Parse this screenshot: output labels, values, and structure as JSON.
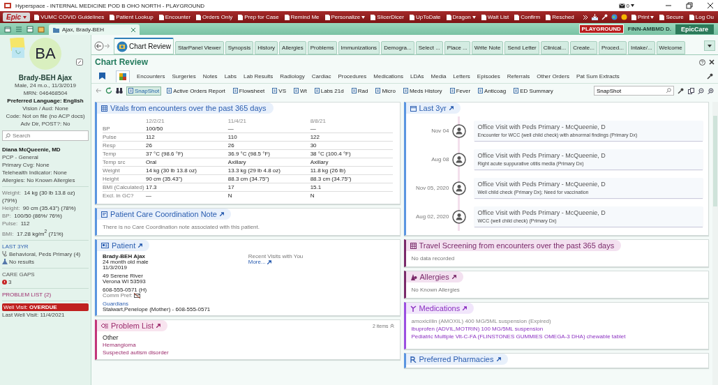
{
  "window": {
    "title": "Hyperspace - INTERNAL MEDICINE POD B OHO NORTH - PLAYGROUND",
    "mail_count": "0"
  },
  "toolbar": {
    "logo": "Epic",
    "items": [
      {
        "label": "VUMC COVID Guidelines",
        "dropdown": false
      },
      {
        "label": "Patient Lookup",
        "dropdown": false
      },
      {
        "label": "Encounter",
        "dropdown": false
      },
      {
        "label": "Orders Only",
        "dropdown": false
      },
      {
        "label": "Prep for Case",
        "dropdown": false
      },
      {
        "label": "Remind Me",
        "dropdown": false
      },
      {
        "label": "Personalize",
        "dropdown": true
      },
      {
        "label": "SlicerDicer",
        "dropdown": false
      },
      {
        "label": "UpToDate",
        "dropdown": false
      },
      {
        "label": "Dragon",
        "dropdown": true
      },
      {
        "label": "Wait List",
        "dropdown": false
      },
      {
        "label": "Confirm",
        "dropdown": false
      },
      {
        "label": "Resched",
        "dropdown": false
      }
    ],
    "right_items": [
      {
        "label": "Print",
        "dropdown": true
      },
      {
        "label": "Secure",
        "dropdown": false
      },
      {
        "label": "Log Ou",
        "dropdown": false
      }
    ]
  },
  "workspace_tabs": {
    "patient_tab": "Ajax, Brady-BEH",
    "environment": "PLAYGROUND",
    "user": "FINN-AMBMD D.",
    "app": "EpicCare"
  },
  "sidebar": {
    "initials": "BA",
    "name": "Brady-BEH Ajax",
    "demographics": [
      {
        "text": "Male, 24 m.o., 11/3/2019",
        "bold": false
      },
      {
        "text": "MRN: 046468504",
        "bold": false
      },
      {
        "text": "Preferred Language: English",
        "bold": true
      },
      {
        "text": "Vision / Aud: None",
        "bold": false
      },
      {
        "text": "Code: Not on file (no ACP docs)",
        "bold": false
      },
      {
        "text": "Adv Dir, POST?: No",
        "bold": false
      }
    ],
    "search": {
      "placeholder": "Search"
    },
    "care_team": [
      {
        "text": "Diana McQueenie, MD",
        "bold": true
      },
      {
        "text": "PCP - General",
        "bold": false
      },
      {
        "text": "Primary Cvg: None",
        "bold": false
      },
      {
        "text": "Telehealth Indicator: None",
        "bold": false
      },
      {
        "text": "Allergies: No Known Allergies",
        "bold": false
      }
    ],
    "vitals": [
      {
        "label": "Weight:",
        "value": "14 kg (30 lb 13.8 oz) (79%)"
      },
      {
        "label": "Height:",
        "value": "90 cm (35.43\") (78%)"
      },
      {
        "label": "BP:",
        "value": "100/50 (86%/ 76%)"
      },
      {
        "label": "Pulse:",
        "value": "112"
      },
      {
        "label": "BMI:",
        "value": "17.28 kg/m$^{2}$ (71%)"
      }
    ],
    "last_3yr": {
      "title": "LAST 3YR",
      "visits": "Behavioral, Peds Primary (4)",
      "results": "No results"
    },
    "care_gaps": {
      "title": "CARE GAPS",
      "count": "3"
    },
    "problem_list": "PROBLEM LIST (2)",
    "well_visit": {
      "text": "Well Visit: **OVERDUE**",
      "overdue": true
    },
    "last_well_visit": "Last Well Visit: 11/4/2021"
  },
  "activity_tabs": [
    {
      "label": "Chart Review",
      "selected": true
    },
    {
      "label": "StarPanel Viewer",
      "selected": false
    },
    {
      "label": "Synopsis",
      "selected": false
    },
    {
      "label": "History",
      "selected": false
    },
    {
      "label": "Allergies",
      "selected": false
    },
    {
      "label": "Problems",
      "selected": false
    },
    {
      "label": "Immunizations",
      "selected": false
    },
    {
      "label": "Demogra...",
      "selected": false
    },
    {
      "label": "Select ...",
      "selected": false
    },
    {
      "label": "Place ...",
      "selected": false
    },
    {
      "label": "Write Note",
      "selected": false
    },
    {
      "label": "Send Letter",
      "selected": false
    },
    {
      "label": "Clinical...",
      "selected": false
    },
    {
      "label": "Create...",
      "selected": false
    },
    {
      "label": "Proced...",
      "selected": false
    },
    {
      "label": "Intake/...",
      "selected": false
    },
    {
      "label": "Welcome",
      "selected": false
    }
  ],
  "chart_review": {
    "title": "Chart Review",
    "view_tabs": [
      {
        "selected": false
      },
      {
        "selected": true
      }
    ],
    "tabs": [
      {
        "label": "Encounters",
        "selected": false
      },
      {
        "label": "Surgeries",
        "selected": false
      },
      {
        "label": "Notes",
        "selected": false
      },
      {
        "label": "Labs",
        "selected": false
      },
      {
        "label": "Lab Results",
        "selected": false
      },
      {
        "label": "Radiology",
        "selected": false
      },
      {
        "label": "Cardiac",
        "selected": false
      },
      {
        "label": "Procedures",
        "selected": false
      },
      {
        "label": "Medications",
        "selected": false
      },
      {
        "label": "LDAs",
        "selected": false
      },
      {
        "label": "Media",
        "selected": false
      },
      {
        "label": "Letters",
        "selected": false
      },
      {
        "label": "Episodes",
        "selected": false
      },
      {
        "label": "Referrals",
        "selected": false
      },
      {
        "label": "Other Orders",
        "selected": false
      },
      {
        "label": "Pat Sum Extracts",
        "selected": false
      }
    ],
    "reports": [
      {
        "label": "SnapShot",
        "selected": true
      },
      {
        "label": "Active Orders Report",
        "selected": false
      },
      {
        "label": "Flowsheet",
        "selected": false
      },
      {
        "label": "VS",
        "selected": false
      },
      {
        "label": "Wt",
        "selected": false
      },
      {
        "label": "Labs 21d",
        "selected": false
      },
      {
        "label": "Rad",
        "selected": false
      },
      {
        "label": "Micro",
        "selected": false
      },
      {
        "label": "Meds History",
        "selected": false
      },
      {
        "label": "Fever",
        "selected": false
      },
      {
        "label": "Anticoag",
        "selected": false
      },
      {
        "label": "ED Summary",
        "selected": false
      }
    ],
    "report_search": {
      "value": "SnapShot"
    }
  },
  "vitals_card": {
    "title": "Vitals from encounters over the past 365 days",
    "dates": [
      "12/2/21",
      "11/4/21",
      "8/8/21"
    ],
    "rows": [
      {
        "label": "BP",
        "values": [
          "100/50",
          "—",
          "—"
        ]
      },
      {
        "label": "Pulse",
        "values": [
          "112",
          "110",
          "122"
        ]
      },
      {
        "label": "Resp",
        "values": [
          "26",
          "26",
          "30"
        ]
      },
      {
        "label": "Temp",
        "values": [
          "37 °C (98.6 °F)",
          "36.9 °C (98.5 °F)",
          "38 °C (100.4 °F)"
        ]
      },
      {
        "label": "Temp src",
        "values": [
          "Oral",
          "Axillary",
          "Axillary"
        ]
      },
      {
        "label": "Weight",
        "values": [
          "14 kg (30 lb 13.8 oz)",
          "13.3 kg (29 lb 4.8 oz)",
          "11.8 kg (26 lb)"
        ]
      },
      {
        "label": "Height",
        "values": [
          "90 cm (35.43\")",
          "88.3 cm (34.75\")",
          "88.3 cm (34.75\")"
        ]
      },
      {
        "label": "BMI (Calculated)",
        "values": [
          "17.3",
          "17",
          "15.1"
        ]
      },
      {
        "label": "Excl. in GC?",
        "values": [
          "—",
          "N",
          "N"
        ]
      }
    ]
  },
  "care_note_card": {
    "title": "Patient Care Coordination Note",
    "text": "There is no Care Coordination note associated with this patient."
  },
  "patient_card": {
    "title": "Patient",
    "name": "Brady-BEH Ajax",
    "age": "24 month old male",
    "dob": "11/3/2019",
    "address": [
      "49 Serene River",
      "Verona WI 53593"
    ],
    "phone": "608-555-0571 (H)",
    "comm_pref": "Comm Pref:",
    "guardians_label": "Guardians",
    "guardian": "Stalwart,Penelope (Mother) - 608-555-0571",
    "recent_visits": "Recent Visits with You",
    "more_link": "More..."
  },
  "problem_card": {
    "title": "Problem List",
    "count": "2 items",
    "group": "Other",
    "problems": [
      "Hemangioma",
      "Suspected autism disorder"
    ]
  },
  "timeline_card": {
    "title": "Last 3yr",
    "visits": [
      {
        "date": "Nov 04",
        "title": "Office Visit with Peds Primary - McQueenie, D",
        "detail": "Encounter for WCC (well child check) with abnormal findings (Primary Dx)"
      },
      {
        "date": "Aug 08",
        "title": "Office Visit with Peds Primary - McQueenie, D",
        "detail": "Right acute suppurative otitis media (Primary Dx)"
      },
      {
        "date": "Nov 05, 2020",
        "title": "Office Visit with Peds Primary - McQueenie, D",
        "detail": "Well child check (Primary Dx); Need for vaccination"
      },
      {
        "date": "Aug 02, 2020",
        "title": "Office Visit with Peds Primary - McQueenie, D",
        "detail": "WCC (well child check) (Primary Dx)"
      }
    ]
  },
  "travel_card": {
    "title": "Travel Screening from encounters over the past 365 days",
    "text": "No data recorded"
  },
  "allergies_card": {
    "title": "Allergies",
    "text": "No Known Allergies"
  },
  "medications_card": {
    "title": "Medications",
    "items": [
      {
        "name": "amoxicillin (AMOXIL) 400 MG/5ML suspension (Expired)",
        "expired": true
      },
      {
        "name": "ibuprofen (ADVIL,MOTRIN) 100 MG/5ML suspension",
        "expired": false
      },
      {
        "name": "Pediatric Multiple Vit-C-FA (FLINSTONES GUMMIES OMEGA-3 DHA) chewable tablet",
        "expired": false
      }
    ]
  },
  "pharmacies_card": {
    "title": "Preferred Pharmacies"
  }
}
